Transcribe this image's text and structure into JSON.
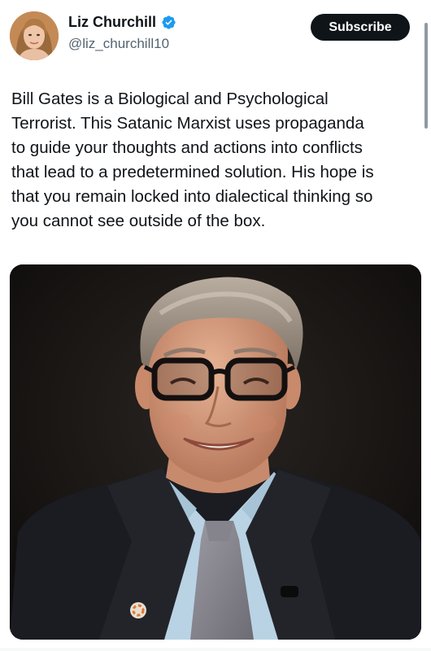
{
  "author": {
    "name": "Liz Churchill",
    "handle": "@liz_churchill10",
    "verified": true,
    "verified_icon": "verified-badge-icon"
  },
  "actions": {
    "subscribe_label": "Subscribe"
  },
  "tweet": {
    "text": "Bill Gates is a Biological and Psychological\nTerrorist. This Satanic Marxist uses propaganda\nto guide your thoughts and actions into conflicts\nthat lead to a predetermined solution. His hope is\nthat you remain locked into dialectical thinking so\nyou cannot see outside of the box."
  },
  "media": {
    "type": "photo"
  },
  "colors": {
    "verified_blue": "#1d9bf0",
    "button_bg": "#0f1419",
    "handle_gray": "#536471"
  }
}
